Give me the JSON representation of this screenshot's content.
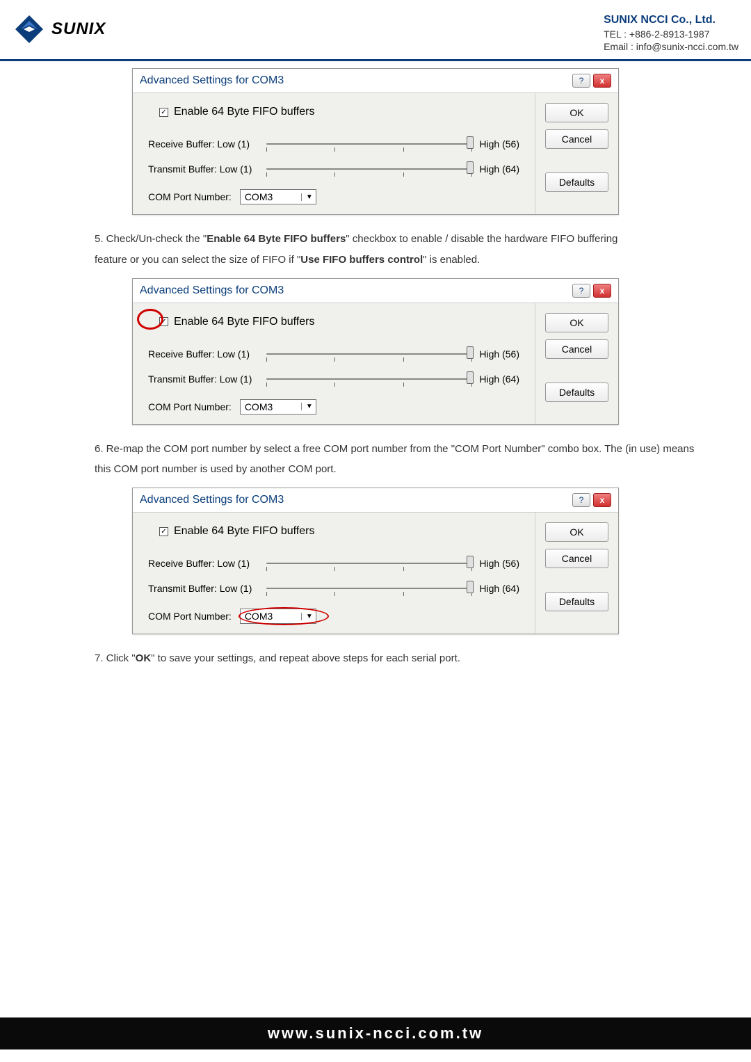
{
  "header": {
    "logo_text": "SUNIX",
    "company_name": "SUNIX NCCI Co., Ltd.",
    "tel": "TEL : +886-2-8913-1987",
    "email": "Email : info@sunix-ncci.com.tw"
  },
  "dialog_common": {
    "title": "Advanced Settings for COM3",
    "enable_fifo_label": "Enable 64 Byte FIFO buffers",
    "receive_label": "Receive Buffer:  Low (1)",
    "receive_high": "High (56)",
    "transmit_label": "Transmit Buffer:  Low (1)",
    "transmit_high": "High (64)",
    "com_port_label": "COM Port Number:",
    "com_port_value": "COM3",
    "ok": "OK",
    "cancel": "Cancel",
    "defaults": "Defaults",
    "help_glyph": "?",
    "close_glyph": "x"
  },
  "instructions": {
    "step5_a": "5. Check/Un-check the \"",
    "step5_b": "Enable 64 Byte FIFO buffers",
    "step5_c": "\" checkbox to enable / disable the hardware FIFO buffering",
    "step5_d": "feature or you can select the size of FIFO if \"",
    "step5_e": "Use FIFO buffers control",
    "step5_f": "\" is enabled.",
    "step6": "6. Re-map the COM port number by select a free COM port number from the \"COM Port Number\" combo box. The (in use) means this COM port number is used by another COM port.",
    "step7_a": "7. Click \"",
    "step7_b": "OK",
    "step7_c": "\" to save your settings, and repeat above steps for each serial port."
  },
  "footer": {
    "url": "www.sunix-ncci.com.tw"
  }
}
